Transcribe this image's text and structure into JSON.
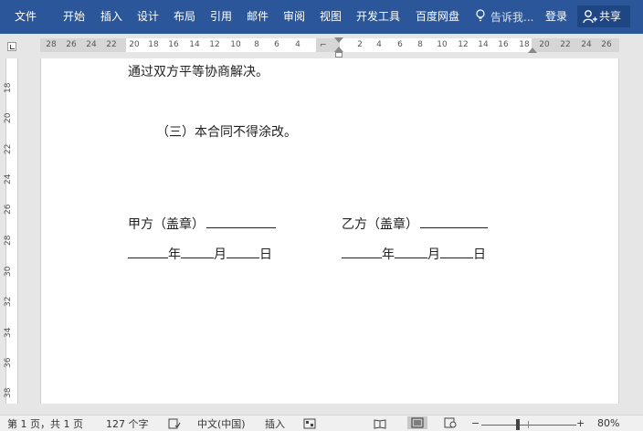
{
  "ribbon": {
    "tabs": [
      "文件",
      "开始",
      "插入",
      "设计",
      "布局",
      "引用",
      "邮件",
      "审阅",
      "视图",
      "开发工具",
      "百度网盘"
    ],
    "tell_me": "告诉我...",
    "login": "登录",
    "share": "共享",
    "icons": {
      "tell_me": "lightbulb-icon",
      "share": "person-add-icon"
    },
    "colors": {
      "bar": "#2b579a",
      "share_bg": "#1d4683"
    }
  },
  "ruler": {
    "horizontal_ticks": [
      "28",
      "26",
      "24",
      "22",
      "20",
      "18",
      "16",
      "14",
      "12",
      "10",
      "8",
      "6",
      "4",
      "2",
      "4",
      "6",
      "8",
      "10",
      "12",
      "14",
      "16",
      "18",
      "20",
      "22",
      "24",
      "26"
    ],
    "vertical_ticks": [
      "18",
      "20",
      "22",
      "24",
      "26",
      "28",
      "30",
      "32",
      "34",
      "36",
      "38"
    ]
  },
  "document": {
    "line1": "通过双方平等协商解决。",
    "line2": "（三）本合同不得涂改。",
    "party_a": "甲方（盖章）",
    "party_b": "乙方（盖章）",
    "year": "年",
    "month": "月",
    "day": "日"
  },
  "status": {
    "page": "第 1 页，共 1 页",
    "words": "127 个字",
    "language": "中文(中国)",
    "mode": "插入",
    "zoom": "80%",
    "zoom_minus": "−",
    "zoom_plus": "+",
    "icons": [
      "proofing-icon",
      "macro-icon",
      "read-mode-icon",
      "print-layout-icon",
      "web-layout-icon"
    ]
  }
}
